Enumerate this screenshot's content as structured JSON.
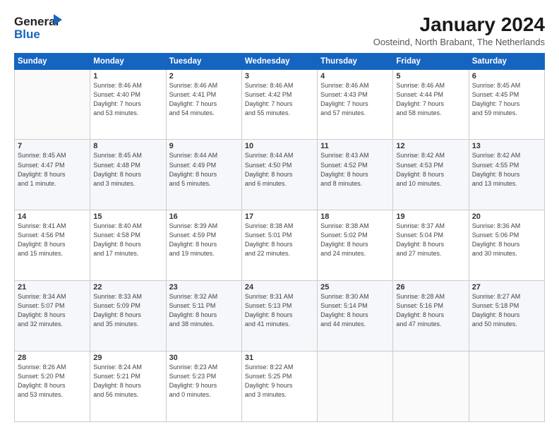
{
  "header": {
    "logo_line1": "General",
    "logo_line2": "Blue",
    "month": "January 2024",
    "location": "Oosteind, North Brabant, The Netherlands"
  },
  "days_of_week": [
    "Sunday",
    "Monday",
    "Tuesday",
    "Wednesday",
    "Thursday",
    "Friday",
    "Saturday"
  ],
  "weeks": [
    [
      {
        "num": "",
        "info": ""
      },
      {
        "num": "1",
        "info": "Sunrise: 8:46 AM\nSunset: 4:40 PM\nDaylight: 7 hours\nand 53 minutes."
      },
      {
        "num": "2",
        "info": "Sunrise: 8:46 AM\nSunset: 4:41 PM\nDaylight: 7 hours\nand 54 minutes."
      },
      {
        "num": "3",
        "info": "Sunrise: 8:46 AM\nSunset: 4:42 PM\nDaylight: 7 hours\nand 55 minutes."
      },
      {
        "num": "4",
        "info": "Sunrise: 8:46 AM\nSunset: 4:43 PM\nDaylight: 7 hours\nand 57 minutes."
      },
      {
        "num": "5",
        "info": "Sunrise: 8:46 AM\nSunset: 4:44 PM\nDaylight: 7 hours\nand 58 minutes."
      },
      {
        "num": "6",
        "info": "Sunrise: 8:45 AM\nSunset: 4:45 PM\nDaylight: 7 hours\nand 59 minutes."
      }
    ],
    [
      {
        "num": "7",
        "info": "Sunrise: 8:45 AM\nSunset: 4:47 PM\nDaylight: 8 hours\nand 1 minute."
      },
      {
        "num": "8",
        "info": "Sunrise: 8:45 AM\nSunset: 4:48 PM\nDaylight: 8 hours\nand 3 minutes."
      },
      {
        "num": "9",
        "info": "Sunrise: 8:44 AM\nSunset: 4:49 PM\nDaylight: 8 hours\nand 5 minutes."
      },
      {
        "num": "10",
        "info": "Sunrise: 8:44 AM\nSunset: 4:50 PM\nDaylight: 8 hours\nand 6 minutes."
      },
      {
        "num": "11",
        "info": "Sunrise: 8:43 AM\nSunset: 4:52 PM\nDaylight: 8 hours\nand 8 minutes."
      },
      {
        "num": "12",
        "info": "Sunrise: 8:42 AM\nSunset: 4:53 PM\nDaylight: 8 hours\nand 10 minutes."
      },
      {
        "num": "13",
        "info": "Sunrise: 8:42 AM\nSunset: 4:55 PM\nDaylight: 8 hours\nand 13 minutes."
      }
    ],
    [
      {
        "num": "14",
        "info": "Sunrise: 8:41 AM\nSunset: 4:56 PM\nDaylight: 8 hours\nand 15 minutes."
      },
      {
        "num": "15",
        "info": "Sunrise: 8:40 AM\nSunset: 4:58 PM\nDaylight: 8 hours\nand 17 minutes."
      },
      {
        "num": "16",
        "info": "Sunrise: 8:39 AM\nSunset: 4:59 PM\nDaylight: 8 hours\nand 19 minutes."
      },
      {
        "num": "17",
        "info": "Sunrise: 8:38 AM\nSunset: 5:01 PM\nDaylight: 8 hours\nand 22 minutes."
      },
      {
        "num": "18",
        "info": "Sunrise: 8:38 AM\nSunset: 5:02 PM\nDaylight: 8 hours\nand 24 minutes."
      },
      {
        "num": "19",
        "info": "Sunrise: 8:37 AM\nSunset: 5:04 PM\nDaylight: 8 hours\nand 27 minutes."
      },
      {
        "num": "20",
        "info": "Sunrise: 8:36 AM\nSunset: 5:06 PM\nDaylight: 8 hours\nand 30 minutes."
      }
    ],
    [
      {
        "num": "21",
        "info": "Sunrise: 8:34 AM\nSunset: 5:07 PM\nDaylight: 8 hours\nand 32 minutes."
      },
      {
        "num": "22",
        "info": "Sunrise: 8:33 AM\nSunset: 5:09 PM\nDaylight: 8 hours\nand 35 minutes."
      },
      {
        "num": "23",
        "info": "Sunrise: 8:32 AM\nSunset: 5:11 PM\nDaylight: 8 hours\nand 38 minutes."
      },
      {
        "num": "24",
        "info": "Sunrise: 8:31 AM\nSunset: 5:13 PM\nDaylight: 8 hours\nand 41 minutes."
      },
      {
        "num": "25",
        "info": "Sunrise: 8:30 AM\nSunset: 5:14 PM\nDaylight: 8 hours\nand 44 minutes."
      },
      {
        "num": "26",
        "info": "Sunrise: 8:28 AM\nSunset: 5:16 PM\nDaylight: 8 hours\nand 47 minutes."
      },
      {
        "num": "27",
        "info": "Sunrise: 8:27 AM\nSunset: 5:18 PM\nDaylight: 8 hours\nand 50 minutes."
      }
    ],
    [
      {
        "num": "28",
        "info": "Sunrise: 8:26 AM\nSunset: 5:20 PM\nDaylight: 8 hours\nand 53 minutes."
      },
      {
        "num": "29",
        "info": "Sunrise: 8:24 AM\nSunset: 5:21 PM\nDaylight: 8 hours\nand 56 minutes."
      },
      {
        "num": "30",
        "info": "Sunrise: 8:23 AM\nSunset: 5:23 PM\nDaylight: 9 hours\nand 0 minutes."
      },
      {
        "num": "31",
        "info": "Sunrise: 8:22 AM\nSunset: 5:25 PM\nDaylight: 9 hours\nand 3 minutes."
      },
      {
        "num": "",
        "info": ""
      },
      {
        "num": "",
        "info": ""
      },
      {
        "num": "",
        "info": ""
      }
    ]
  ]
}
